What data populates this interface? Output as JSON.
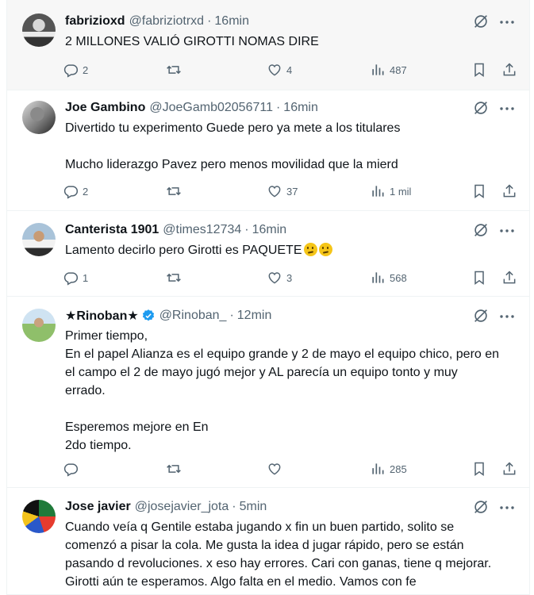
{
  "tweets": [
    {
      "name": "fabrizioxd",
      "handle": "@fabriziotrxd",
      "time": "16min",
      "verified": false,
      "lines": [
        "2 MILLONES VALIÓ GIROTTI NOMAS DIRE"
      ],
      "emoji_count": 0,
      "replies": "2",
      "reposts": "",
      "likes": "4",
      "views": "487"
    },
    {
      "name": "Joe Gambino",
      "handle": "@JoeGamb02056711",
      "time": "16min",
      "verified": false,
      "lines": [
        "Divertido tu experimento Guede pero ya mete a los titulares",
        "",
        "Mucho liderazgo Pavez pero menos movilidad que la mierd"
      ],
      "emoji_count": 0,
      "replies": "2",
      "reposts": "",
      "likes": "37",
      "views": "1 mil"
    },
    {
      "name": "Canterista 1901",
      "handle": "@times12734",
      "time": "16min",
      "verified": false,
      "lines": [
        "Lamento decirlo pero Girotti es PAQUETE"
      ],
      "emoji_count": 2,
      "replies": "1",
      "reposts": "",
      "likes": "3",
      "views": "568"
    },
    {
      "name": "★Rinoban★",
      "handle": "@Rinoban_",
      "time": "12min",
      "verified": true,
      "lines": [
        "Primer tiempo,",
        "En el papel Alianza es el equipo grande y 2 de mayo el equipo chico, pero en",
        "el campo el 2 de mayo jugó mejor y AL parecía un equipo tonto y muy",
        "errado.",
        "",
        "Esperemos mejore en En",
        "2do tiempo."
      ],
      "emoji_count": 0,
      "replies": "",
      "reposts": "",
      "likes": "",
      "views": "285"
    },
    {
      "name": "Jose javier",
      "handle": "@josejavier_jota",
      "time": "5min",
      "verified": false,
      "lines": [
        "Cuando veía q Gentile estaba jugando x fin un buen partido, solito se",
        "comenzó a pisar la cola. Me gusta la idea d jugar rápido, pero se están",
        "pasando d revoluciones. x eso hay errores. Cari con ganas, tiene q mejorar.",
        "Girotti aún te esperamos. Algo falta en el medio. Vamos con fe"
      ],
      "emoji_count": 0,
      "replies": "",
      "reposts": "",
      "likes": "",
      "views": ""
    }
  ],
  "colors": {
    "verified": "#1d9bf0",
    "muted": "#536471",
    "text": "#0f1419",
    "hover_bg": "#f7f7f7"
  },
  "icons": [
    "reply-icon",
    "repost-icon",
    "like-icon",
    "views-icon",
    "bookmark-icon",
    "share-icon",
    "grok-icon",
    "more-icon",
    "verified-badge-icon"
  ]
}
